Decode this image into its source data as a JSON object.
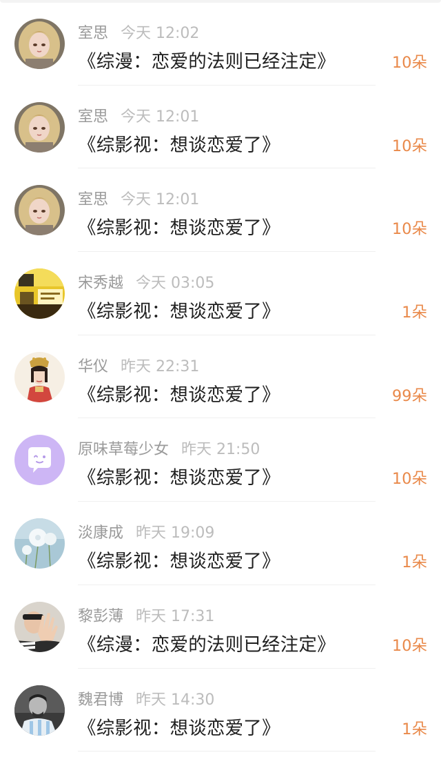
{
  "gifts": [
    {
      "user": "室思",
      "time": "今天 12:02",
      "title": "《综漫：恋爱的法则已经注定》",
      "count": "10朵",
      "avatar_icon": "anime-girl-avatar"
    },
    {
      "user": "室思",
      "time": "今天 12:01",
      "title": "《综影视：想谈恋爱了》",
      "count": "10朵",
      "avatar_icon": "anime-girl-avatar"
    },
    {
      "user": "室思",
      "time": "今天 12:01",
      "title": "《综影视：想谈恋爱了》",
      "count": "10朵",
      "avatar_icon": "anime-girl-avatar"
    },
    {
      "user": "宋秀越",
      "time": "今天 03:05",
      "title": "《综影视：想谈恋爱了》",
      "count": "1朵",
      "avatar_icon": "yellow-scene-avatar"
    },
    {
      "user": "华仪",
      "time": "昨天 22:31",
      "title": "《综影视：想谈恋爱了》",
      "count": "99朵",
      "avatar_icon": "costume-lady-avatar"
    },
    {
      "user": "原味草莓少女",
      "time": "昨天 21:50",
      "title": "《综影视：想谈恋爱了》",
      "count": "10朵",
      "avatar_icon": "chat-bubble-avatar"
    },
    {
      "user": "淡康成",
      "time": "昨天 19:09",
      "title": "《综影视：想谈恋爱了》",
      "count": "1朵",
      "avatar_icon": "dandelion-avatar"
    },
    {
      "user": "黎彭薄",
      "time": "昨天 17:31",
      "title": "《综漫：恋爱的法则已经注定》",
      "count": "10朵",
      "avatar_icon": "waving-hand-avatar"
    },
    {
      "user": "魏君博",
      "time": "昨天 14:30",
      "title": "《综影视：想谈恋爱了》",
      "count": "1朵",
      "avatar_icon": "athlete-avatar"
    }
  ],
  "colors": {
    "count": "#e9894a",
    "username": "#9a9a9a",
    "time": "#bcbcbc",
    "title": "#1f1f1f",
    "chat_avatar_bg": "#cdb6f5"
  }
}
